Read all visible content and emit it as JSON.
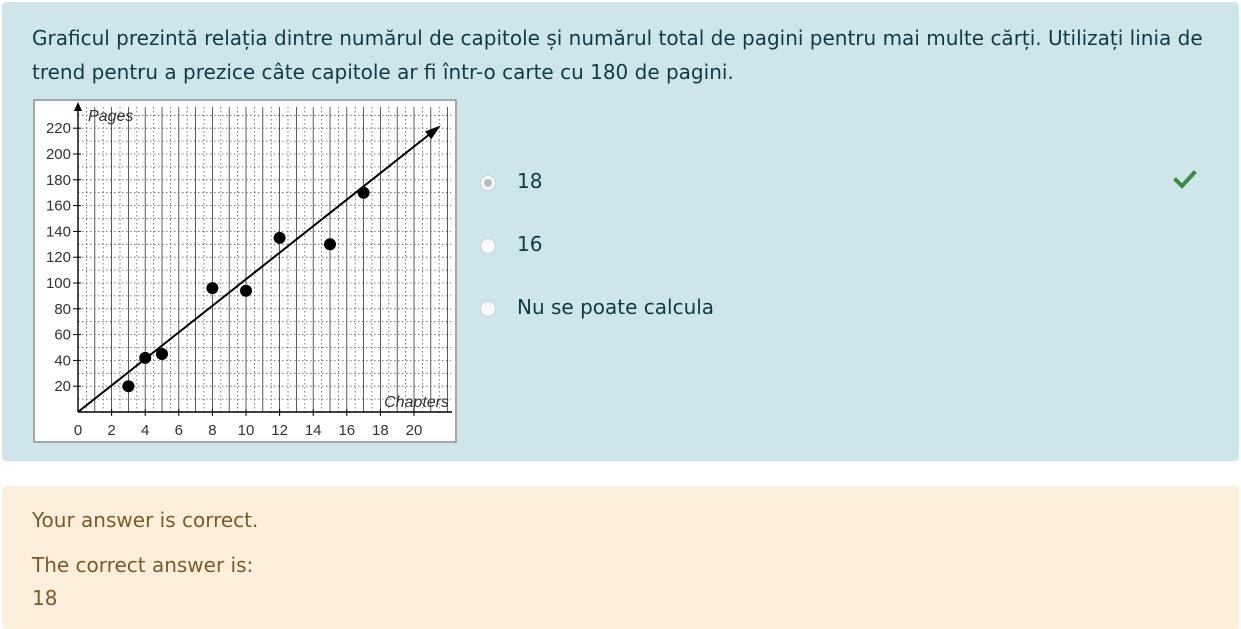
{
  "question": {
    "text": "Graficul prezintă relația dintre numărul de capitole și numărul total de pagini pentru mai multe cărți. Utilizați linia de trend pentru a prezice câte capitole ar fi într-o carte cu 180 de pagini."
  },
  "chart_data": {
    "type": "scatter",
    "title": "",
    "xlabel": "Chapters",
    "ylabel": "Pages",
    "xlim": [
      0,
      22
    ],
    "ylim": [
      0,
      230
    ],
    "x_ticks": [
      0,
      2,
      4,
      6,
      8,
      10,
      12,
      14,
      16,
      18,
      20
    ],
    "y_ticks": [
      20,
      40,
      60,
      80,
      100,
      120,
      140,
      160,
      180,
      200,
      220
    ],
    "grid": true,
    "points": [
      {
        "x": 3,
        "y": 20
      },
      {
        "x": 4,
        "y": 42
      },
      {
        "x": 5,
        "y": 45
      },
      {
        "x": 8,
        "y": 96
      },
      {
        "x": 10,
        "y": 94
      },
      {
        "x": 12,
        "y": 135
      },
      {
        "x": 15,
        "y": 130
      },
      {
        "x": 17,
        "y": 170
      }
    ],
    "trend_line": {
      "x": [
        0,
        22
      ],
      "y": [
        0,
        228
      ]
    }
  },
  "answers": [
    {
      "label": "18",
      "selected": true,
      "correct": true
    },
    {
      "label": "16",
      "selected": false,
      "correct": false
    },
    {
      "label": "Nu se poate calcula",
      "selected": false,
      "correct": false
    }
  ],
  "icons": {
    "correct": "check-icon"
  },
  "colors": {
    "correct": "#3c8a3c",
    "question_bg": "#cee6ea",
    "feedback_bg": "#fcefdc"
  },
  "feedback": {
    "status": "Your answer is correct.",
    "correct_label": "The correct answer is:",
    "correct_value": "18"
  }
}
